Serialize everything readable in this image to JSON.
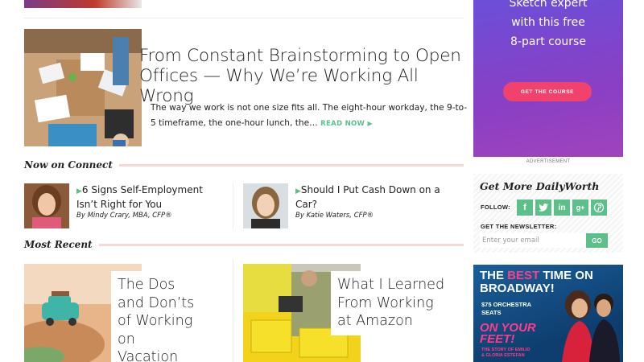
{
  "featured": {
    "title": "From Constant Brainstorming to Open Offices — Why We’re Working All Wrong",
    "excerpt": "The way we work is not one size fits all. The eight-hour workday, the 9-to-5 timeframe, the one-hour lunch, the…",
    "read_more": "READ NOW"
  },
  "now_on_connect": {
    "heading": "Now on Connect",
    "items": [
      {
        "title": "6 Signs Self-Employment Isn’t Right for You",
        "author": "By Mindy Crary, MBA, CFP®"
      },
      {
        "title": "Should I Put Cash Down on a Car?",
        "author": "By Katie Waters, CFP®"
      }
    ]
  },
  "most_recent": {
    "heading": "Most Recent",
    "items": [
      {
        "title": "The Dos and Don’ts of Working on Vacation"
      },
      {
        "title": "What I Learned From Working at Amazon"
      }
    ]
  },
  "sidebar": {
    "course_ad": {
      "text_line1": "Sketch expert",
      "text_line2": "with this free",
      "text_line3": "8-part course",
      "button": "GET THE COURSE",
      "label": "ADVERTISEMENT"
    },
    "get_more": {
      "title": "Get More DailyWorth",
      "follow_label": "FOLLOW:",
      "social_icons": [
        "facebook-icon",
        "twitter-icon",
        "linkedin-icon",
        "google-plus-icon",
        "pinterest-icon"
      ],
      "newsletter_label": "GET THE NEWSLETTER:",
      "email_placeholder": "Enter your email",
      "go_button": "GO"
    },
    "broadway_ad": {
      "head_prefix": "THE ",
      "head_best": "BEST",
      "head_rest": " TIME ON",
      "head_line2": "BROADWAY!",
      "sub_line1": "$75 ORCHESTRA",
      "sub_line2": "SEATS",
      "show_line1": "ON YOUR",
      "show_line2": "FEET!",
      "small_line1": "THE STORY OF EMILIO",
      "small_line2": "& GLORIA ESTEFAN"
    }
  },
  "colors": {
    "accent_green": "#5dbf8a",
    "heading_rule": "#f6d9d6",
    "ad_pink": "#f0426d"
  }
}
